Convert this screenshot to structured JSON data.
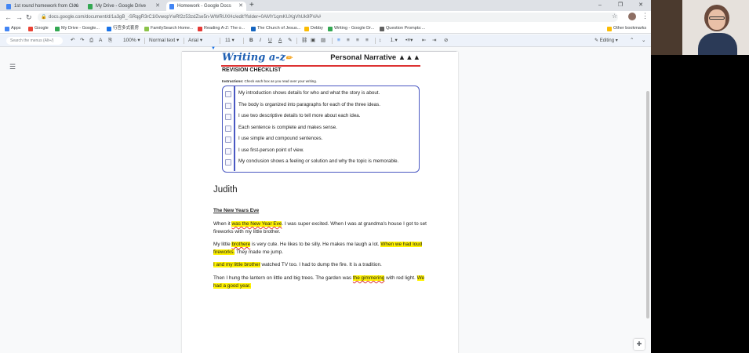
{
  "tabs": [
    {
      "label": "1st round homework from Clou",
      "color": "#4285f4",
      "active": false
    },
    {
      "label": "My Drive - Google Drive",
      "color": "#34a853",
      "active": false
    },
    {
      "label": "Homework - Google Docs",
      "color": "#4285f4",
      "active": true
    }
  ],
  "window": {
    "minimize": "–",
    "restore": "❐",
    "close": "✕"
  },
  "url": "docs.google.com/document/d/1a3gB_-SRqgR3rC1l0vwopYwRf2z53zdZse5n-WWRUXHc/edit?folder=0AMY1qmKUXgVhUk9PVA#",
  "bookmarks": [
    "Apps",
    "Google",
    "My Drive - Google...",
    "行宫多式套房",
    "FamilySearch Home...",
    "Reading A-Z: The o...",
    "The Church of Jesus...",
    "Debby",
    "Writing - Google Dr...",
    "Question Prompts:..."
  ],
  "other_bookmarks": "Other bookmarks",
  "toolbar": {
    "search": "Search the menus (Alt+/)",
    "zoom": "100%",
    "style": "Normal text",
    "font": "Arial",
    "size": "11",
    "editing": "Editing"
  },
  "checklist": {
    "logo": "Writing a-z",
    "title_right": "Personal Narrative ▲▲▲",
    "heading": "REVISION CHECKLIST",
    "instr_bold": "Instructions:",
    "instr": " Check each box as you read over your writing.",
    "items": [
      "My introduction shows details for who and what the story is about.",
      "The body is organized into paragraphs for each of the three ideas.",
      "I use two descriptive details to tell more about each idea.",
      "Each sentence is complete and makes sense.",
      "I use simple and compound sentences.",
      "I use first-person point of view.",
      "My conclusion shows a feeling or solution and why the topic is memorable."
    ]
  },
  "doc": {
    "author": "Judith",
    "story_title": "The New Years Eve",
    "p1": {
      "a": "When it ",
      "b": "was the New Year Eve",
      "c": ". I was super excited. When I was at grandma's house I got to set fireworks with my little brother."
    },
    "p2": {
      "a": "My little ",
      "b": "brothere",
      "c": " is very cute. He likes to be silly. He makes me laugh a lot. ",
      "d": "When we had loud fireworks.",
      "e": " They made me jump."
    },
    "p3": {
      "a": "I and my little brother",
      "b": " watched TV too. I had to dump the fire. It is a tradition."
    },
    "p4": {
      "a": "Then I hung the lantern on little and big trees. The garden was ",
      "b": "the gimmering",
      "c": " with red light. ",
      "d": "We had a good year."
    }
  }
}
